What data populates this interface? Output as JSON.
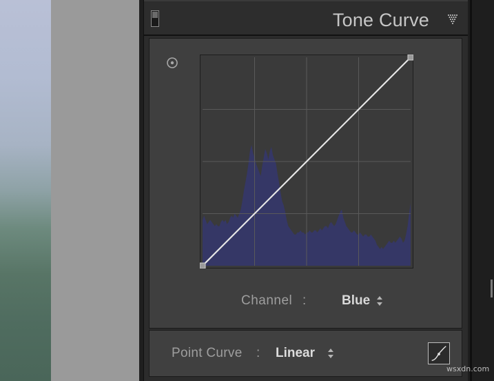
{
  "panel": {
    "title": "Tone Curve",
    "switch_icon": "panel-switch-icon",
    "collapse_icon": "triangle-down-dotted-icon"
  },
  "curve": {
    "target_icon": "target-adjust-icon",
    "channel_label": "Channel",
    "channel_colon": ":",
    "channel_value": "Blue",
    "channel_stepper_icon": "up-down-stepper-icon",
    "histogram_color": "#353766",
    "line_color": "#e6e6e6",
    "grid_color": "#5a5a5a",
    "point_color": "#9a9a9a",
    "control_points": [
      [
        0,
        0
      ],
      [
        1,
        1
      ]
    ],
    "histogram_profile": [
      0.22,
      0.24,
      0.22,
      0.2,
      0.21,
      0.22,
      0.21,
      0.2,
      0.19,
      0.2,
      0.19,
      0.19,
      0.21,
      0.22,
      0.21,
      0.22,
      0.2,
      0.21,
      0.23,
      0.24,
      0.23,
      0.25,
      0.24,
      0.23,
      0.25,
      0.27,
      0.31,
      0.36,
      0.4,
      0.44,
      0.49,
      0.55,
      0.58,
      0.54,
      0.52,
      0.49,
      0.47,
      0.45,
      0.43,
      0.48,
      0.52,
      0.56,
      0.54,
      0.51,
      0.55,
      0.57,
      0.53,
      0.51,
      0.49,
      0.44,
      0.4,
      0.35,
      0.31,
      0.29,
      0.26,
      0.22,
      0.19,
      0.18,
      0.17,
      0.16,
      0.15,
      0.15,
      0.16,
      0.16,
      0.17,
      0.16,
      0.16,
      0.15,
      0.16,
      0.16,
      0.17,
      0.16,
      0.16,
      0.17,
      0.17,
      0.16,
      0.17,
      0.18,
      0.17,
      0.18,
      0.19,
      0.19,
      0.18,
      0.2,
      0.21,
      0.2,
      0.19,
      0.2,
      0.22,
      0.24,
      0.26,
      0.27,
      0.23,
      0.21,
      0.19,
      0.18,
      0.17,
      0.16,
      0.16,
      0.17,
      0.16,
      0.15,
      0.15,
      0.16,
      0.15,
      0.14,
      0.15,
      0.15,
      0.14,
      0.14,
      0.15,
      0.14,
      0.13,
      0.12,
      0.1,
      0.09,
      0.08,
      0.09,
      0.08,
      0.09,
      0.1,
      0.11,
      0.12,
      0.11,
      0.11,
      0.12,
      0.11,
      0.12,
      0.13,
      0.14,
      0.13,
      0.11,
      0.12,
      0.15,
      0.19,
      0.25,
      0.3
    ]
  },
  "footer": {
    "point_curve_label": "Point Curve",
    "point_curve_colon": ":",
    "point_curve_value": "Linear",
    "stepper_icon": "up-down-stepper-icon",
    "edit_curve_icon": "edit-point-curve-icon"
  },
  "watermark": "wsxdn.com"
}
